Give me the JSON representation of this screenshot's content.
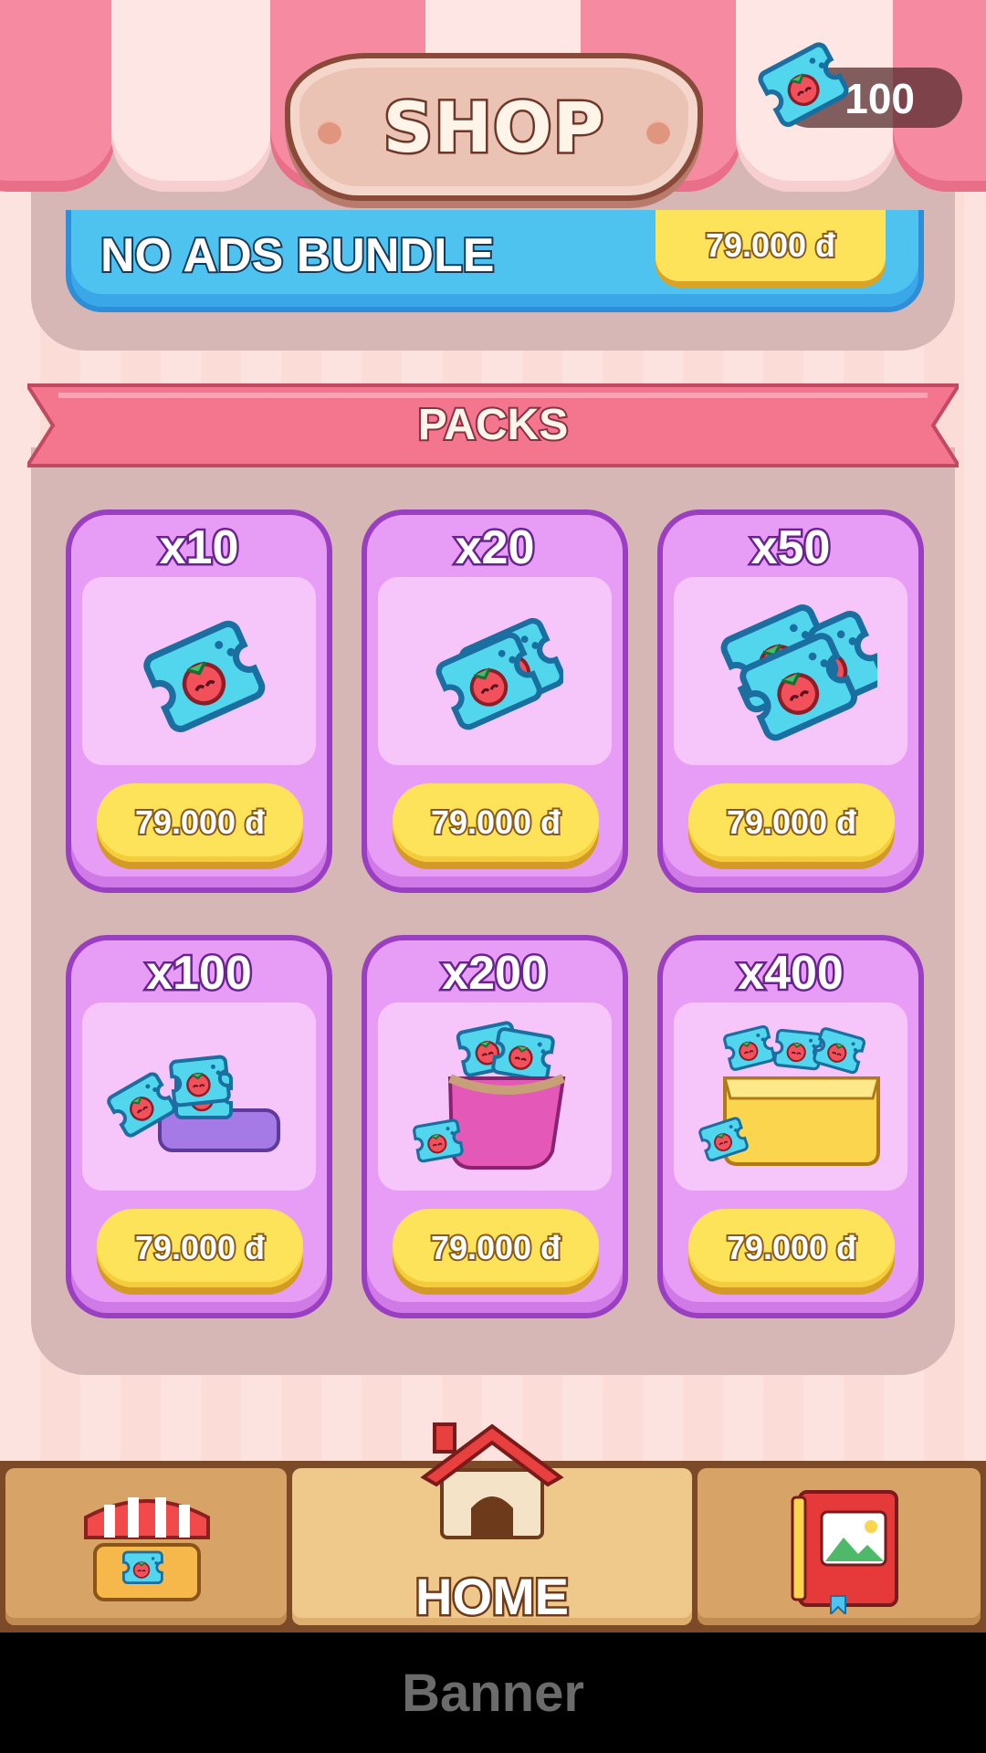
{
  "header": {
    "title": "SHOP"
  },
  "currency": {
    "value": "100",
    "icon": "ticket-icon"
  },
  "no_ads": {
    "title": "NO ADS BUNDLE",
    "price": "79.000 đ"
  },
  "packs": {
    "title": "PACKS",
    "items": [
      {
        "label": "x10",
        "price": "79.000 đ",
        "icon": "ticket-single-icon"
      },
      {
        "label": "x20",
        "price": "79.000 đ",
        "icon": "ticket-pair-icon"
      },
      {
        "label": "x50",
        "price": "79.000 đ",
        "icon": "ticket-stack-icon"
      },
      {
        "label": "x100",
        "price": "79.000 đ",
        "icon": "ticket-tray-icon"
      },
      {
        "label": "x200",
        "price": "79.000 đ",
        "icon": "ticket-purse-icon"
      },
      {
        "label": "x400",
        "price": "79.000 đ",
        "icon": "ticket-box-icon"
      }
    ]
  },
  "nav": {
    "home_label": "HOME",
    "tabs": [
      "shop-icon",
      "home-icon",
      "album-icon"
    ]
  },
  "banner": {
    "text": "Banner"
  },
  "colors": {
    "awning_pink": "#f58aa0",
    "card_purple": "#e79df6",
    "button_yellow": "#fde35a",
    "no_ads_blue": "#4fc3f0"
  }
}
